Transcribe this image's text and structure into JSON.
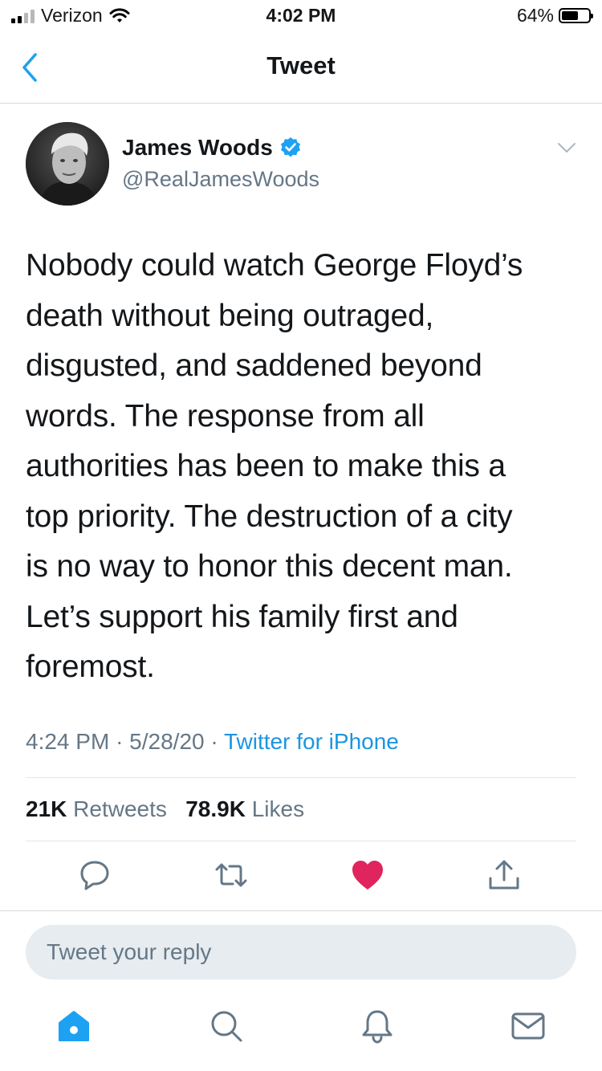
{
  "status_bar": {
    "carrier": "Verizon",
    "time": "4:02 PM",
    "battery_percent": "64%",
    "battery_level": 0.64
  },
  "nav": {
    "title": "Tweet"
  },
  "author": {
    "name": "James Woods",
    "handle": "@RealJamesWoods",
    "verified": true
  },
  "tweet": {
    "text": "Nobody could watch George Floyd’s\ndeath without being outraged,\ndisgusted, and saddened beyond\nwords. The response from all\nauthorities has been to make this a\ntop priority. The destruction of a city\nis no way to honor this decent man.\nLet’s support his family first and\nforemost.",
    "time": "4:24 PM",
    "date": "5/28/20",
    "separator": "·",
    "source": "Twitter for iPhone"
  },
  "stats": {
    "retweets_count": "21K",
    "retweets_label": "Retweets",
    "likes_count": "78.9K",
    "likes_label": "Likes"
  },
  "actions": [
    "reply-icon",
    "retweet-icon",
    "liked-heart-icon",
    "share-icon"
  ],
  "reply": {
    "placeholder": "Tweet your reply"
  },
  "tabbar": [
    "home-icon",
    "search-icon",
    "notifications-icon",
    "messages-icon"
  ],
  "colors": {
    "accent": "#1da1f2",
    "like": "#e0245e",
    "muted": "#657786",
    "link": "#1b95e0"
  }
}
